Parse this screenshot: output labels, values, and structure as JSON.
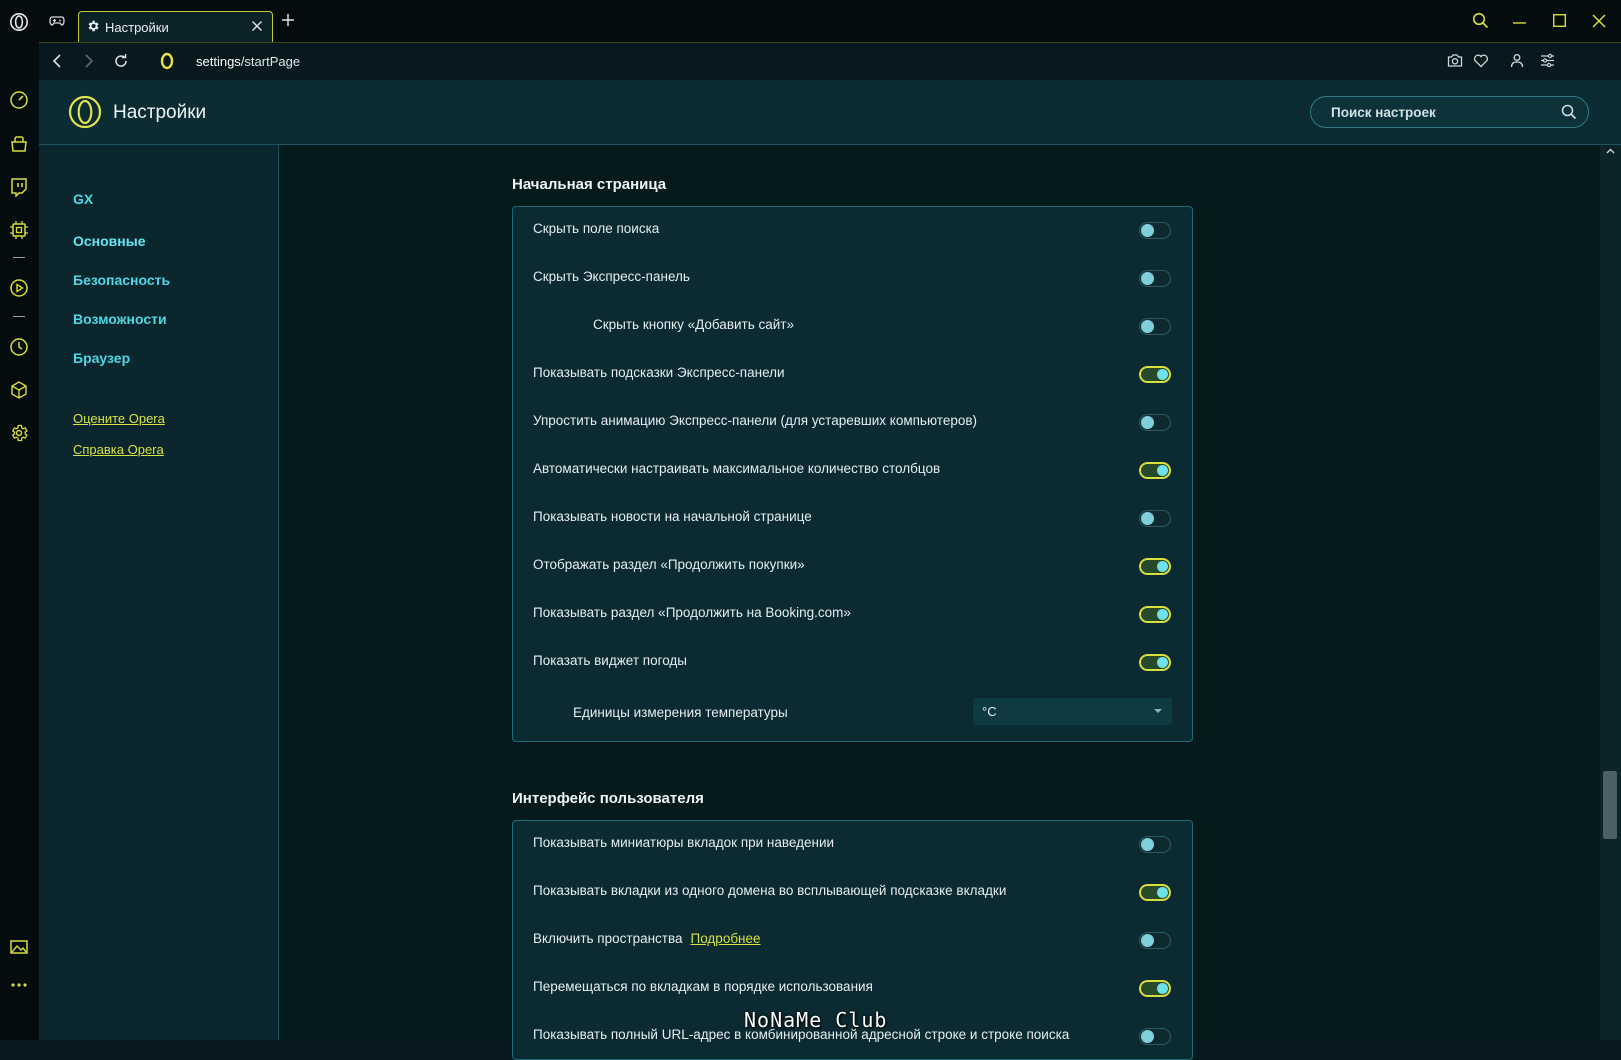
{
  "tab": {
    "title": "Настройки"
  },
  "address": {
    "host": "settings",
    "path": "/startPage"
  },
  "header": {
    "title": "Настройки",
    "search_placeholder": "Поиск настроек"
  },
  "nav": {
    "items": [
      "GX",
      "Основные",
      "Безопасность",
      "Возможности",
      "Браузер"
    ],
    "active": "Основные",
    "links": [
      "Оцените Opera",
      "Справка Opera"
    ]
  },
  "sections": [
    {
      "title": "Начальная страница",
      "rows": [
        {
          "label": "Скрыть поле поиска",
          "on": false
        },
        {
          "label": "Скрыть Экспресс-панель",
          "on": false
        },
        {
          "label": "Скрыть кнопку «Добавить сайт»",
          "on": false,
          "indent": true
        },
        {
          "label": "Показывать подсказки Экспресс-панели",
          "on": true
        },
        {
          "label": "Упростить анимацию Экспресс-панели (для устаревших компьютеров)",
          "on": false
        },
        {
          "label": "Автоматически настраивать максимальное количество столбцов",
          "on": true
        },
        {
          "label": "Показывать новости на начальной странице",
          "on": false
        },
        {
          "label": "Отображать раздел «Продолжить покупки»",
          "on": true
        },
        {
          "label": "Показывать раздел «Продолжить на Booking.com»",
          "on": true
        },
        {
          "label": "Показать виджет погоды",
          "on": true
        },
        {
          "label": "Единицы измерения температуры",
          "select": "°C"
        }
      ]
    },
    {
      "title": "Интерфейс пользователя",
      "rows": [
        {
          "label": "Показывать миниатюры вкладок при наведении",
          "on": false
        },
        {
          "label": "Показывать вкладки из одного домена во всплывающей подсказке вкладки",
          "on": true
        },
        {
          "label": "Включить пространства",
          "link": "Подробнее",
          "on": false
        },
        {
          "label": "Перемещаться по вкладкам в порядке использования",
          "on": true
        },
        {
          "label": "Показывать полный URL-адрес в комбинированной адресной строке и строке поиска",
          "on": false
        }
      ]
    }
  ],
  "watermark": "NoNaMe Club",
  "colors": {
    "accent": "#dadd3e",
    "cyan": "#4fd7e6",
    "background": "#061a1e"
  }
}
